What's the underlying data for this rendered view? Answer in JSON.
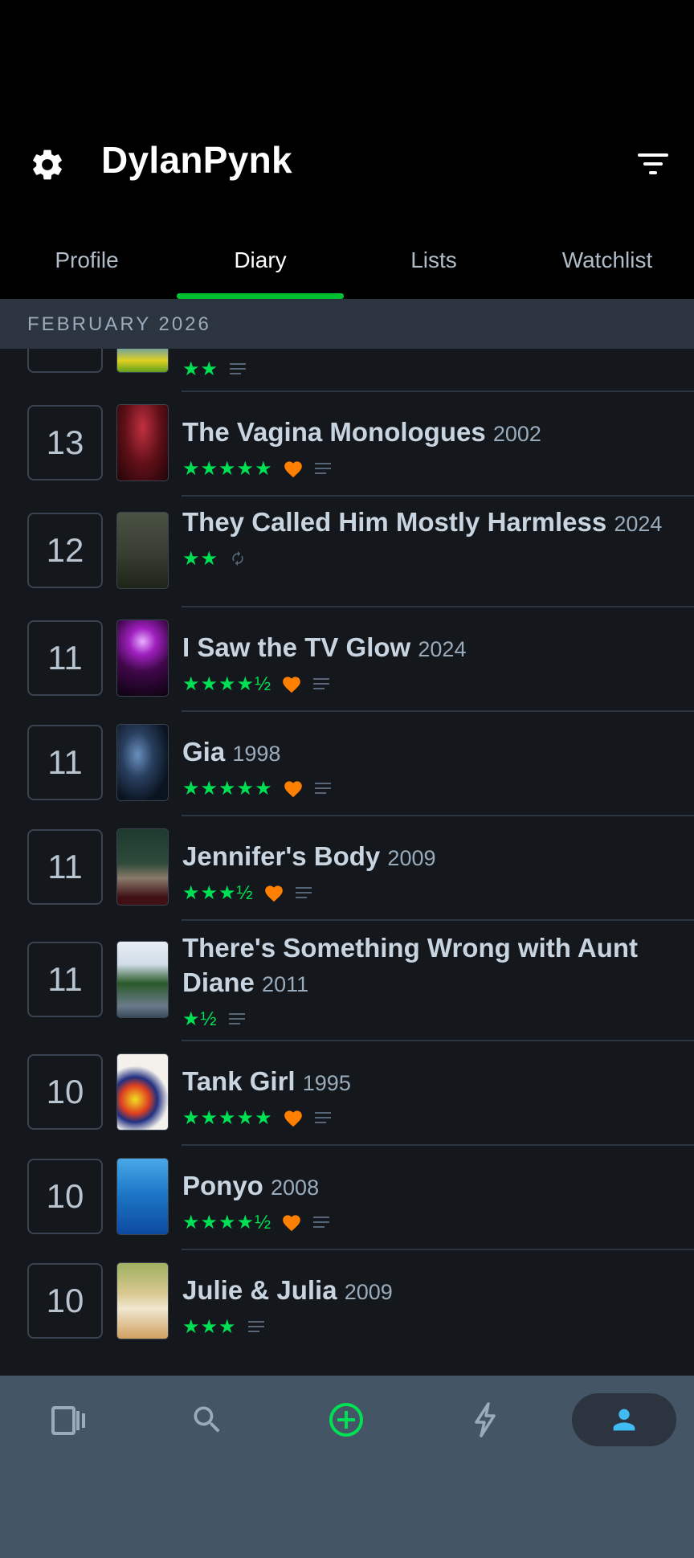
{
  "header": {
    "title": "DylanPynk",
    "settings_icon": "gear-icon",
    "filter_icon": "filter-icon"
  },
  "tabs": [
    {
      "label": "Profile",
      "active": false
    },
    {
      "label": "Diary",
      "active": true
    },
    {
      "label": "Lists",
      "active": false
    },
    {
      "label": "Watchlist",
      "active": false
    }
  ],
  "section": {
    "label": "FEBRUARY 2026"
  },
  "partial_entry": {
    "stars": "★★"
  },
  "entries": [
    {
      "day": "13",
      "title": "The Vagina Monologues",
      "year": "2002",
      "stars": "★★★★★",
      "liked": true,
      "review": true,
      "rewatch": false
    },
    {
      "day": "12",
      "title": "They Called Him Mostly Harmless",
      "year": "2024",
      "stars": "★★",
      "liked": false,
      "review": false,
      "rewatch": true
    },
    {
      "day": "11",
      "title": "I Saw the TV Glow",
      "year": "2024",
      "stars": "★★★★½",
      "liked": true,
      "review": true,
      "rewatch": false
    },
    {
      "day": "11",
      "title": "Gia",
      "year": "1998",
      "stars": "★★★★★",
      "liked": true,
      "review": true,
      "rewatch": false
    },
    {
      "day": "11",
      "title": "Jennifer's Body",
      "year": "2009",
      "stars": "★★★½",
      "liked": true,
      "review": true,
      "rewatch": false
    },
    {
      "day": "11",
      "title": "There's Something Wrong with Aunt Diane",
      "year": "2011",
      "stars": "★½",
      "liked": false,
      "review": true,
      "rewatch": false
    },
    {
      "day": "10",
      "title": "Tank Girl",
      "year": "1995",
      "stars": "★★★★★",
      "liked": true,
      "review": true,
      "rewatch": false
    },
    {
      "day": "10",
      "title": "Ponyo",
      "year": "2008",
      "stars": "★★★★½",
      "liked": true,
      "review": true,
      "rewatch": false
    },
    {
      "day": "10",
      "title": "Julie & Julia",
      "year": "2009",
      "stars": "★★★",
      "liked": false,
      "review": true,
      "rewatch": false
    }
  ],
  "colors": {
    "accent_green": "#00e054",
    "like_orange": "#ff8000",
    "profile_blue": "#40bcf4"
  },
  "bottom_nav": [
    {
      "icon": "films-icon",
      "active": false
    },
    {
      "icon": "search-icon",
      "active": false
    },
    {
      "icon": "add-icon",
      "active": false
    },
    {
      "icon": "activity-icon",
      "active": false
    },
    {
      "icon": "profile-icon",
      "active": true
    }
  ]
}
